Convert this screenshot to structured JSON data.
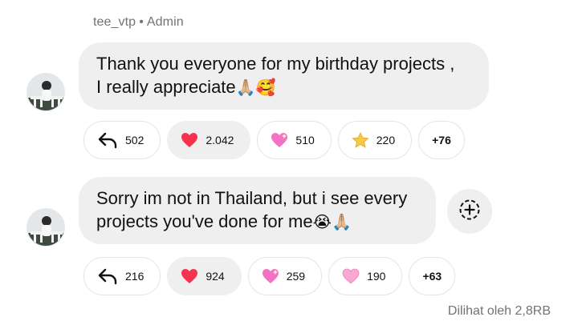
{
  "sender": {
    "name": "tee_vtp",
    "separator": "•",
    "role": "Admin"
  },
  "messages": [
    {
      "lines": [
        "Thank you everyone for my birthday projects ,",
        "I really appreciate"
      ],
      "trailing_emoji": "🙏🏼🥰",
      "reactions": [
        {
          "icon": "reply-icon",
          "count": "502"
        },
        {
          "icon": "red-heart-icon",
          "count": "2.042",
          "active": true
        },
        {
          "icon": "sparkling-heart-icon",
          "count": "510"
        },
        {
          "icon": "star-icon",
          "count": "220"
        },
        {
          "more": "+76"
        }
      ]
    },
    {
      "lines": [
        "Sorry im not in Thailand, but i see every",
        "projects you've done for me"
      ],
      "trailing_emoji": "😭🙏🏼",
      "reactions": [
        {
          "icon": "reply-icon",
          "count": "216"
        },
        {
          "icon": "red-heart-icon",
          "count": "924",
          "active": true
        },
        {
          "icon": "sparkling-heart-icon",
          "count": "259"
        },
        {
          "icon": "pink-heart-icon",
          "count": "190"
        },
        {
          "more": "+63"
        }
      ]
    }
  ],
  "seen_label": "Dilihat oleh 2,8RB",
  "colors": {
    "bubble": "#efefef",
    "muted_text": "#737373",
    "heart_red": "#f5334f",
    "heart_pink": "#f9a8d4"
  }
}
